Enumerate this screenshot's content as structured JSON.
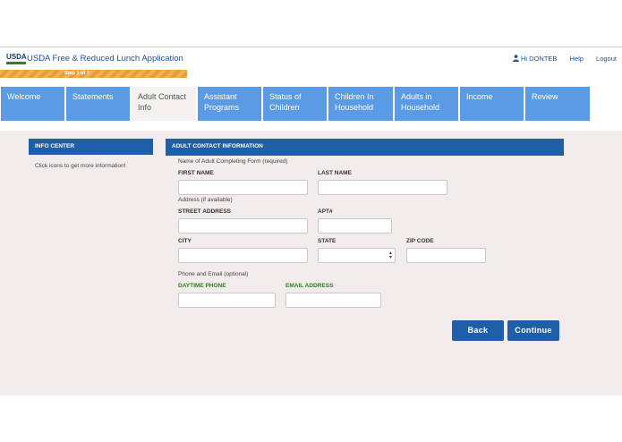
{
  "header": {
    "logo_text": "USDA",
    "app_title": "USDA Free & Reduced Lunch Application",
    "user_greeting": "Hi DONTEB",
    "help_label": "Help",
    "logout_label": "Logout"
  },
  "progress": {
    "label": "Step 1 of 7"
  },
  "nav": {
    "tabs": [
      {
        "label": "Welcome"
      },
      {
        "label": "Statements"
      },
      {
        "label": "Adult Contact Info"
      },
      {
        "label": "Assistant Programs"
      },
      {
        "label": "Status of Children"
      },
      {
        "label": "Children In Household"
      },
      {
        "label": "Adults in Household"
      },
      {
        "label": "Income"
      },
      {
        "label": "Review"
      }
    ]
  },
  "info_center": {
    "heading": "INFO CENTER",
    "text": "Click  icons to get more information!"
  },
  "form": {
    "heading": "ADULT CONTACT INFORMATION",
    "adult_note": "Name of Adult Completing Form (required)",
    "first_name_label": "FIRST NAME",
    "first_name_value": "",
    "last_name_label": "LAST NAME",
    "last_name_value": "",
    "address_note": "Address (if available)",
    "street_label": "STREET ADDRESS",
    "street_value": "",
    "apt_label": "APT#",
    "apt_value": "",
    "city_label": "CITY",
    "city_value": "",
    "state_label": "STATE",
    "state_value": "",
    "zip_label": "ZIP CODE",
    "zip_value": "",
    "contact_note": "Phone and Email (optional)",
    "phone_label": "DAYTIME PHONE",
    "phone_value": "",
    "email_label": "EMAIL ADDRESS",
    "email_value": ""
  },
  "buttons": {
    "back": "Back",
    "continue": "Continue"
  },
  "colors": {
    "tab_blue": "#5b9be5",
    "header_blue": "#1f5fa8",
    "progress_orange": "#f3b04c",
    "content_bg": "#f3eced",
    "green_label": "#2e7d1e"
  }
}
